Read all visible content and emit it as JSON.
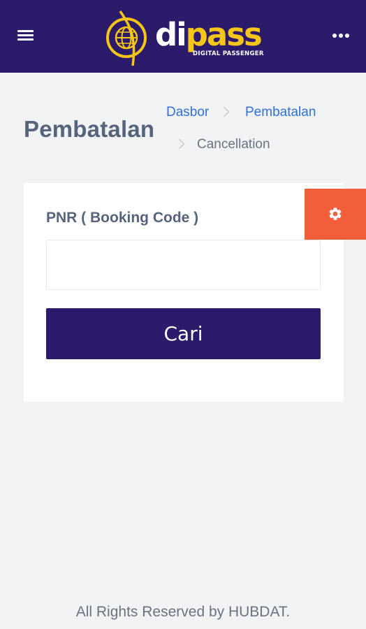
{
  "header": {
    "brand_primary": "di",
    "brand_secondary": "pass",
    "brand_tagline": "DIGITAL PASSENGER",
    "menu_icon": "hamburger-icon",
    "more_icon": "more-horizontal-icon",
    "colors": {
      "bar": "#2c1a6b",
      "brand_accent": "#f5c518"
    }
  },
  "page": {
    "title": "Pembatalan"
  },
  "breadcrumb": {
    "items": [
      {
        "label": "Dasbor"
      },
      {
        "label": "Pembatalan"
      },
      {
        "label": "Cancellation"
      }
    ]
  },
  "form": {
    "pnr_label": "PNR ( Booking Code )",
    "pnr_value": "",
    "pnr_placeholder": "",
    "search_button": "Cari"
  },
  "settings": {
    "icon": "gear-icon",
    "color": "#f25d3a"
  },
  "footer": {
    "text": "All Rights Reserved by HUBDAT."
  }
}
